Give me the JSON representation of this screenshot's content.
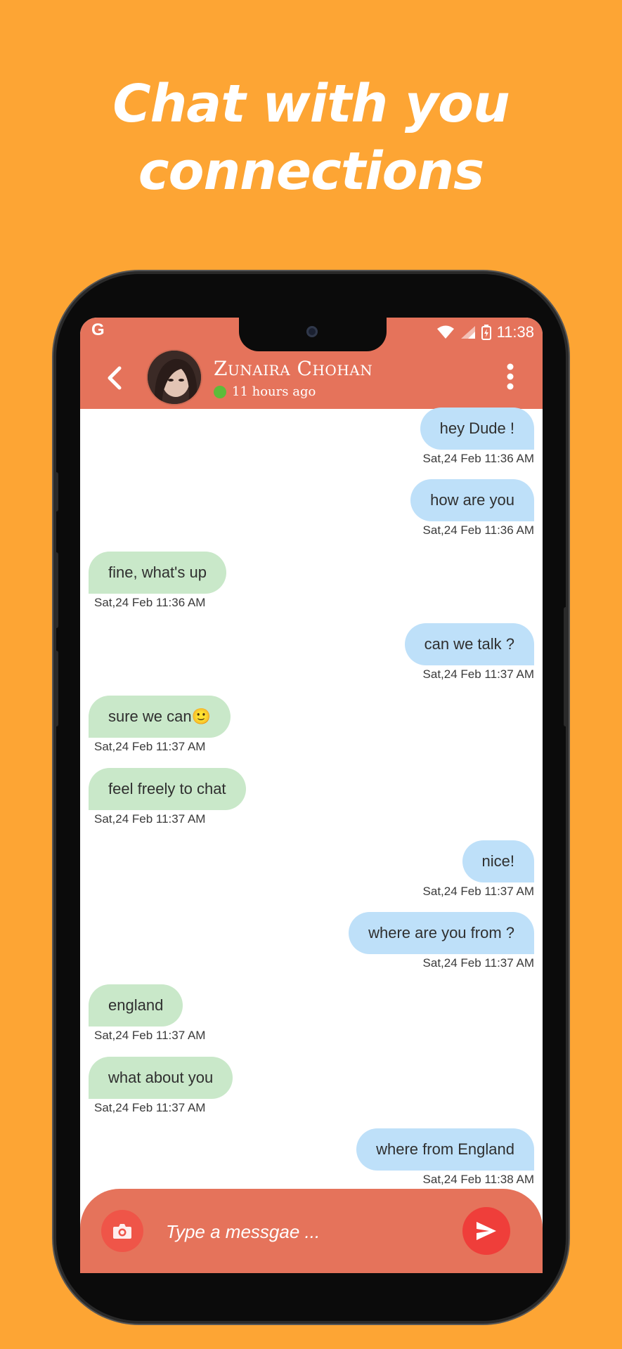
{
  "headline": {
    "line1": "Chat with you",
    "line2": "connections"
  },
  "status_bar": {
    "left_icon": "G",
    "time": "11:38"
  },
  "chat_header": {
    "contact_name": "Zunaira Chohan",
    "last_seen": "11 hours ago",
    "back_icon": "chevron-left-icon",
    "menu_icon": "more-vertical-icon"
  },
  "messages": [
    {
      "side": "out",
      "text": "hey Dude !",
      "timestamp": "Sat,24 Feb   11:36 AM"
    },
    {
      "side": "out",
      "text": "how are you",
      "timestamp": "Sat,24 Feb   11:36 AM"
    },
    {
      "side": "in",
      "text": "fine, what's up",
      "timestamp": "Sat,24 Feb   11:36 AM"
    },
    {
      "side": "out",
      "text": "can we talk ?",
      "timestamp": "Sat,24 Feb   11:37 AM"
    },
    {
      "side": "in",
      "text": "sure we can🙂",
      "timestamp": "Sat,24 Feb   11:37 AM"
    },
    {
      "side": "in",
      "text": "feel freely to chat",
      "timestamp": "Sat,24 Feb   11:37 AM"
    },
    {
      "side": "out",
      "text": "nice!",
      "timestamp": "Sat,24 Feb   11:37 AM"
    },
    {
      "side": "out",
      "text": "where are you from ?",
      "timestamp": "Sat,24 Feb   11:37 AM"
    },
    {
      "side": "in",
      "text": "england",
      "timestamp": "Sat,24 Feb   11:37 AM"
    },
    {
      "side": "in",
      "text": "what about you",
      "timestamp": "Sat,24 Feb   11:37 AM"
    },
    {
      "side": "out",
      "text": "where from England",
      "timestamp": "Sat,24 Feb   11:38 AM"
    }
  ],
  "composer": {
    "placeholder": "Type a messgae ...",
    "camera_icon": "camera-icon",
    "send_icon": "send-icon"
  },
  "colors": {
    "background": "#FDA534",
    "app_bar": "#E5735B",
    "outgoing_bubble": "#BEE0F9",
    "incoming_bubble": "#C9E8C9",
    "send_button": "#EF3E3A",
    "online_dot": "#5dbb3a"
  }
}
